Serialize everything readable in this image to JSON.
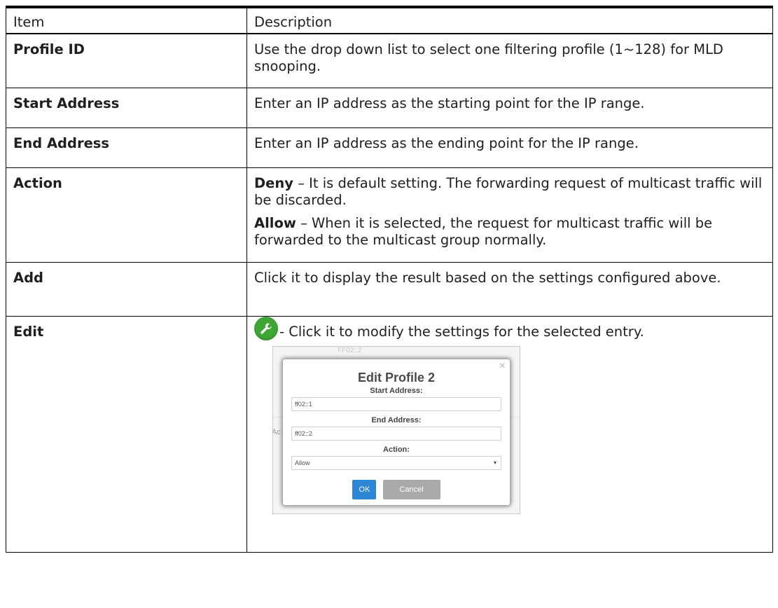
{
  "table": {
    "header": {
      "item": "Item",
      "description": "Description"
    },
    "rows": {
      "profile_id": {
        "item": "Profile ID",
        "description": "Use the drop down list to select one filtering profile (1~128) for MLD snooping."
      },
      "start_address": {
        "item": "Start Address",
        "description": "Enter an IP address as the starting point for the IP range."
      },
      "end_address": {
        "item": "End Address",
        "description": "Enter an IP address as the ending point for the IP range."
      },
      "action": {
        "item": "Action",
        "deny_term": "Deny",
        "deny_text": " – It is default setting. The forwarding request of multicast traffic will be discarded.",
        "allow_term": "Allow",
        "allow_text": " – When it is selected, the request for multicast traffic will be forwarded to the multicast group normally."
      },
      "add": {
        "item": "Add",
        "description": "Click it to display the result based on the settings configured above."
      },
      "edit": {
        "item": "Edit",
        "icon": "wrench-icon",
        "description": "- Click it to modify the settings for the selected entry."
      }
    }
  },
  "edit_dialog": {
    "background_label": "FF02::2",
    "background_fragment": "Ac",
    "title": "Edit Profile 2",
    "start_label": "Start Address:",
    "start_value": "ff02::1",
    "end_label": "End Address:",
    "end_value": "ff02::2",
    "action_label": "Action:",
    "action_value": "Allow",
    "close_icon": "×",
    "ok_label": "OK",
    "cancel_label": "Cancel"
  },
  "colors": {
    "wrench_icon": "#3fa535",
    "ok_button": "#2e86d6",
    "cancel_button": "#a9a9a9"
  }
}
